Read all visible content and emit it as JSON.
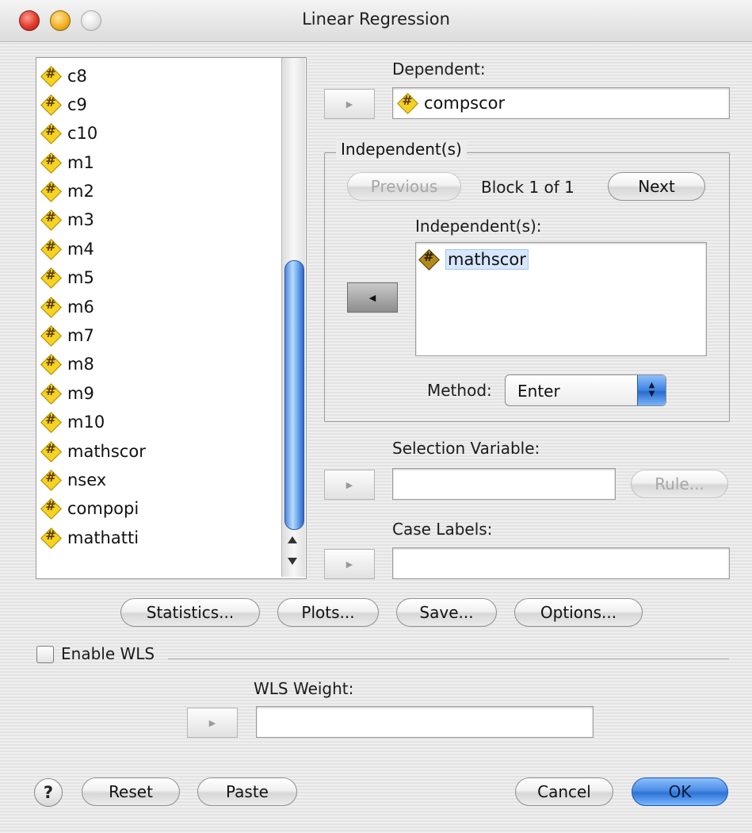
{
  "window": {
    "title": "Linear Regression"
  },
  "variables": [
    {
      "name": "c8",
      "icon": "numeric-variable-icon"
    },
    {
      "name": "c9",
      "icon": "numeric-variable-icon"
    },
    {
      "name": "c10",
      "icon": "numeric-variable-icon"
    },
    {
      "name": "m1",
      "icon": "numeric-variable-icon"
    },
    {
      "name": "m2",
      "icon": "numeric-variable-icon"
    },
    {
      "name": "m3",
      "icon": "numeric-variable-icon"
    },
    {
      "name": "m4",
      "icon": "numeric-variable-icon"
    },
    {
      "name": "m5",
      "icon": "numeric-variable-icon"
    },
    {
      "name": "m6",
      "icon": "numeric-variable-icon"
    },
    {
      "name": "m7",
      "icon": "numeric-variable-icon"
    },
    {
      "name": "m8",
      "icon": "numeric-variable-icon"
    },
    {
      "name": "m9",
      "icon": "numeric-variable-icon"
    },
    {
      "name": "m10",
      "icon": "numeric-variable-icon"
    },
    {
      "name": "mathscor",
      "icon": "numeric-variable-icon"
    },
    {
      "name": "nsex",
      "icon": "numeric-variable-icon"
    },
    {
      "name": "compopi",
      "icon": "numeric-variable-icon"
    },
    {
      "name": "mathatti",
      "icon": "numeric-variable-icon"
    }
  ],
  "dependent": {
    "label": "Dependent:",
    "value": "compscor"
  },
  "independents": {
    "group_label": "Independent(s)",
    "previous_label": "Previous",
    "block_text": "Block 1 of 1",
    "next_label": "Next",
    "list_label": "Independent(s):",
    "items": [
      "mathscor"
    ]
  },
  "method": {
    "label": "Method:",
    "value": "Enter"
  },
  "selection": {
    "label": "Selection Variable:",
    "value": "",
    "rule_label": "Rule..."
  },
  "case_labels": {
    "label": "Case Labels:",
    "value": ""
  },
  "buttons": {
    "statistics": "Statistics...",
    "plots": "Plots...",
    "save": "Save...",
    "options": "Options..."
  },
  "wls": {
    "enable_label": "Enable WLS",
    "weight_label": "WLS Weight:",
    "value": ""
  },
  "footer": {
    "help": "?",
    "reset": "Reset",
    "paste": "Paste",
    "cancel": "Cancel",
    "ok": "OK"
  },
  "colors": {
    "accent": "#3a7be0",
    "variable_icon": "#f6d222"
  }
}
